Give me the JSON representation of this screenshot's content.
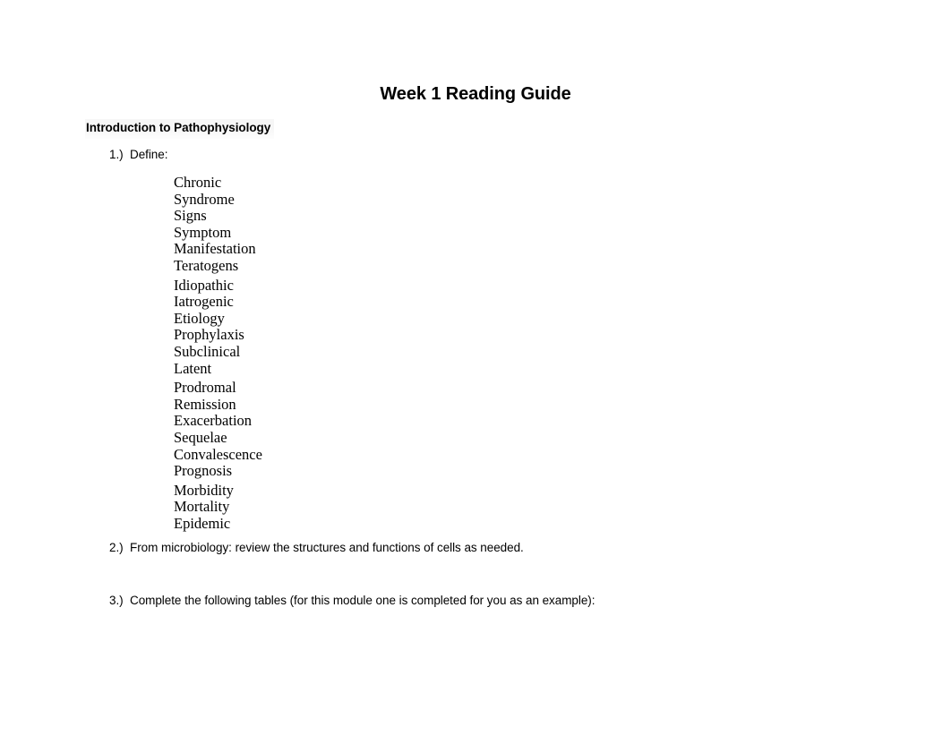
{
  "document": {
    "title": "Week 1 Reading Guide",
    "section_heading": "Introduction to Pathophysiology",
    "heading_highlight_color": "#f2f2f2",
    "text_color": "#000000",
    "page_background": "#ffffff"
  },
  "items": [
    {
      "number": "1.)",
      "text": "Define:"
    },
    {
      "number": "2.)",
      "text": "From microbiology: review the structures and functions of cells as needed."
    },
    {
      "number": "3.)",
      "text": "Complete the following tables (for this module one is completed for you as an example):"
    }
  ],
  "term_groups": [
    {
      "terms": [
        "Chronic",
        "Syndrome",
        "Signs",
        "Symptom",
        "Manifestation",
        "Teratogens"
      ]
    },
    {
      "terms": [
        "Idiopathic",
        "Iatrogenic",
        "Etiology",
        "Prophylaxis",
        "Subclinical",
        "Latent"
      ]
    },
    {
      "terms": [
        "Prodromal",
        "Remission",
        "Exacerbation",
        "Sequelae",
        "Convalescence",
        "Prognosis"
      ]
    },
    {
      "terms": [
        "Morbidity",
        "Mortality",
        "Epidemic"
      ]
    }
  ]
}
